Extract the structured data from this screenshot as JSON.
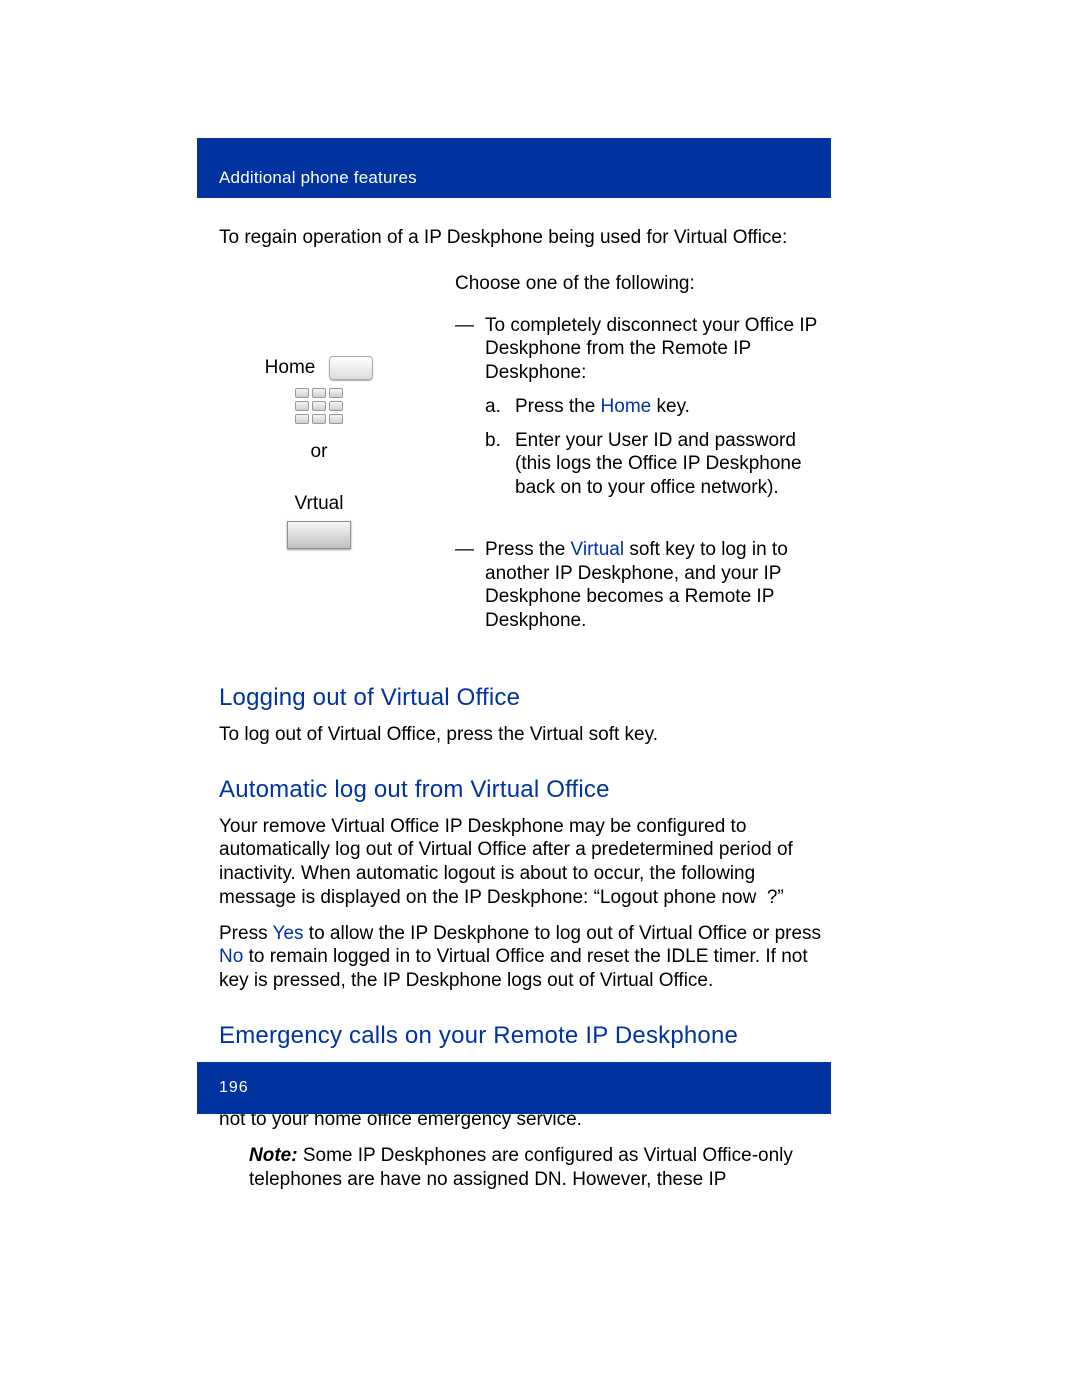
{
  "header": {
    "title": "Additional phone features"
  },
  "intro": "To regain operation of a IP Deskphone being used for Virtual Office:",
  "instructions": {
    "left": {
      "home_label": "Home",
      "or_label": "or",
      "virtual_label": "Vrtual"
    },
    "right": {
      "choose": "Choose one of the following:",
      "dash1_prefix": "To completely disconnect your Office IP Deskphone from the Remote IP Deskphone:",
      "step_a_pre": "Press the ",
      "step_a_link": "Home",
      "step_a_post": " key.",
      "step_b": "Enter your User ID and password (this logs the Office IP Deskphone back on to your office network).",
      "dash2_pre": "Press the ",
      "dash2_link": "Virtual",
      "dash2_post": "  soft key to log in to another IP Deskphone, and your IP Deskphone becomes a Remote IP Deskphone."
    }
  },
  "sections": {
    "logout_heading": "Logging out of Virtual Office",
    "logout_para": "To log out of Virtual Office, press the Virtual soft key.",
    "auto_heading": "Automatic log out from Virtual Office",
    "auto_para1": "Your remove Virtual Office IP Deskphone may be configured to automatically log out of Virtual Office after a predetermined period of inactivity. When automatic logout is about to occur, the following message is displayed on the IP Deskphone: “Logout phone now  ?”",
    "auto_para2_pre": "Press ",
    "auto_para2_yes": "Yes",
    "auto_para2_mid": " to allow the IP Deskphone to log out of Virtual Office or press ",
    "auto_para2_no": "No",
    "auto_para2_post": " to remain logged in to Virtual Office and reset the IDLE timer. If not key is pressed, the IP Deskphone logs out of Virtual Office.",
    "emergency_heading": "Emergency calls on your Remote IP Deskphone",
    "emergency_para": "If you make an emergency call while logged in to Virtual Office on a Remote IP Deskphone, the call is placed to the local emergency service, not to your home office emergency service.",
    "note_label": "Note:",
    "note_text": " Some IP Deskphones are configured as Virtual Office-only telephones are have no assigned DN. However, these IP"
  },
  "footer": {
    "page": "196"
  },
  "markers": {
    "dash": "—",
    "a": "a.",
    "b": "b."
  }
}
